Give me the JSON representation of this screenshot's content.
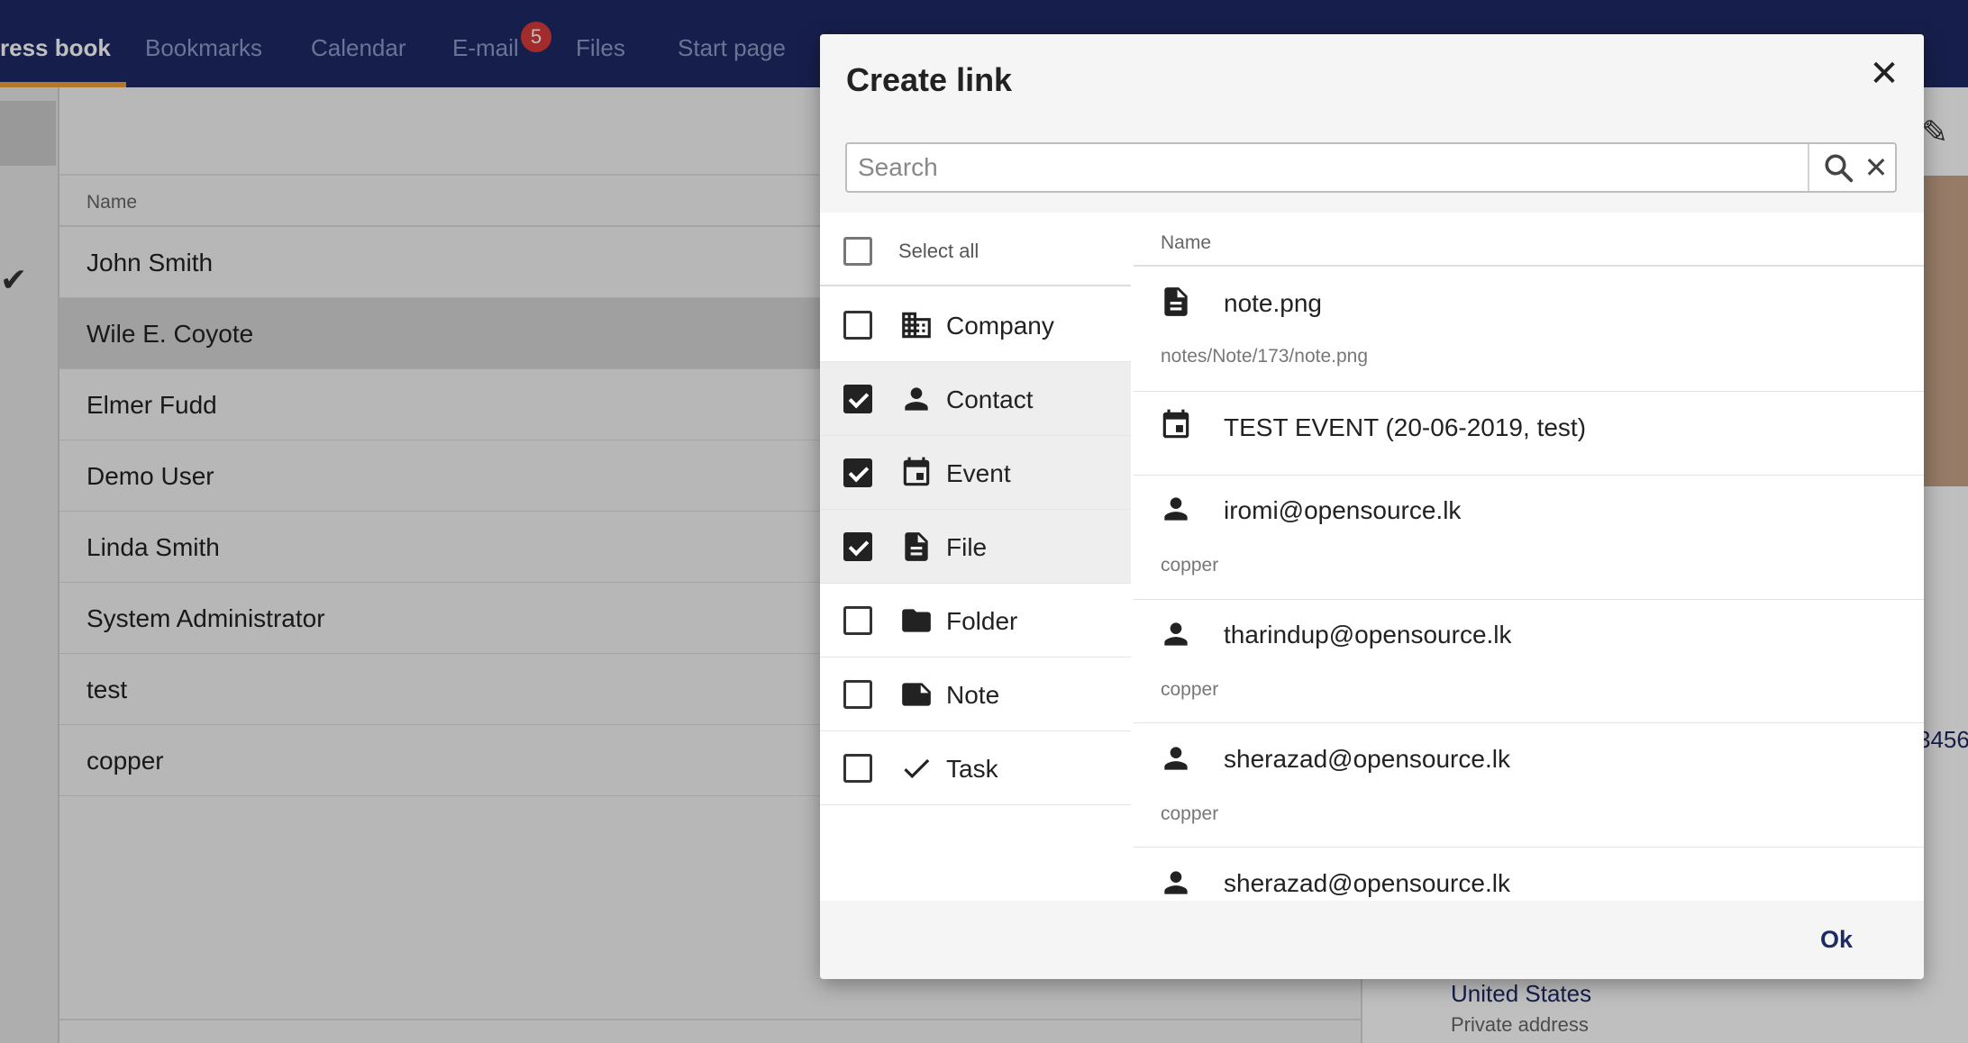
{
  "nav": {
    "tabs": [
      "ress book",
      "Bookmarks",
      "Calendar",
      "E-mail",
      "Files",
      "Start page"
    ],
    "email_badge": "5",
    "accent": "#f0a13a",
    "bar_color": "#1e2a64"
  },
  "contacts": {
    "column_header": "Name",
    "rows": [
      "John Smith",
      "Wile E. Coyote",
      "Elmer Fudd",
      "Demo User",
      "Linda Smith",
      "System Administrator",
      "test",
      "copper"
    ],
    "selected_row": "Wile E. Coyote"
  },
  "detail": {
    "country": "United States",
    "address_type": "Private address",
    "phone_fragment": "3456"
  },
  "dialog": {
    "title": "Create link",
    "search_placeholder": "Search",
    "search_value": "",
    "select_all_label": "Select all",
    "filters": [
      {
        "label": "Company",
        "icon": "company-icon",
        "checked": false
      },
      {
        "label": "Contact",
        "icon": "person-icon",
        "checked": true
      },
      {
        "label": "Event",
        "icon": "calendar-icon",
        "checked": true
      },
      {
        "label": "File",
        "icon": "file-icon",
        "checked": true
      },
      {
        "label": "Folder",
        "icon": "folder-icon",
        "checked": false
      },
      {
        "label": "Note",
        "icon": "note-icon",
        "checked": false
      },
      {
        "label": "Task",
        "icon": "check-icon",
        "checked": false
      }
    ],
    "results_header": "Name",
    "results": [
      {
        "name": "note.png",
        "sub": "notes/Note/173/note.png",
        "icon": "file-icon"
      },
      {
        "name": "TEST EVENT (20-06-2019, test)",
        "sub": "",
        "icon": "calendar-icon"
      },
      {
        "name": "iromi@opensource.lk",
        "sub": "copper",
        "icon": "person-icon"
      },
      {
        "name": "tharindup@opensource.lk",
        "sub": "copper",
        "icon": "person-icon"
      },
      {
        "name": "sherazad@opensource.lk",
        "sub": "copper",
        "icon": "person-icon"
      },
      {
        "name": "sherazad@opensource.lk",
        "sub": "",
        "icon": "person-icon"
      }
    ],
    "ok_label": "Ok"
  }
}
